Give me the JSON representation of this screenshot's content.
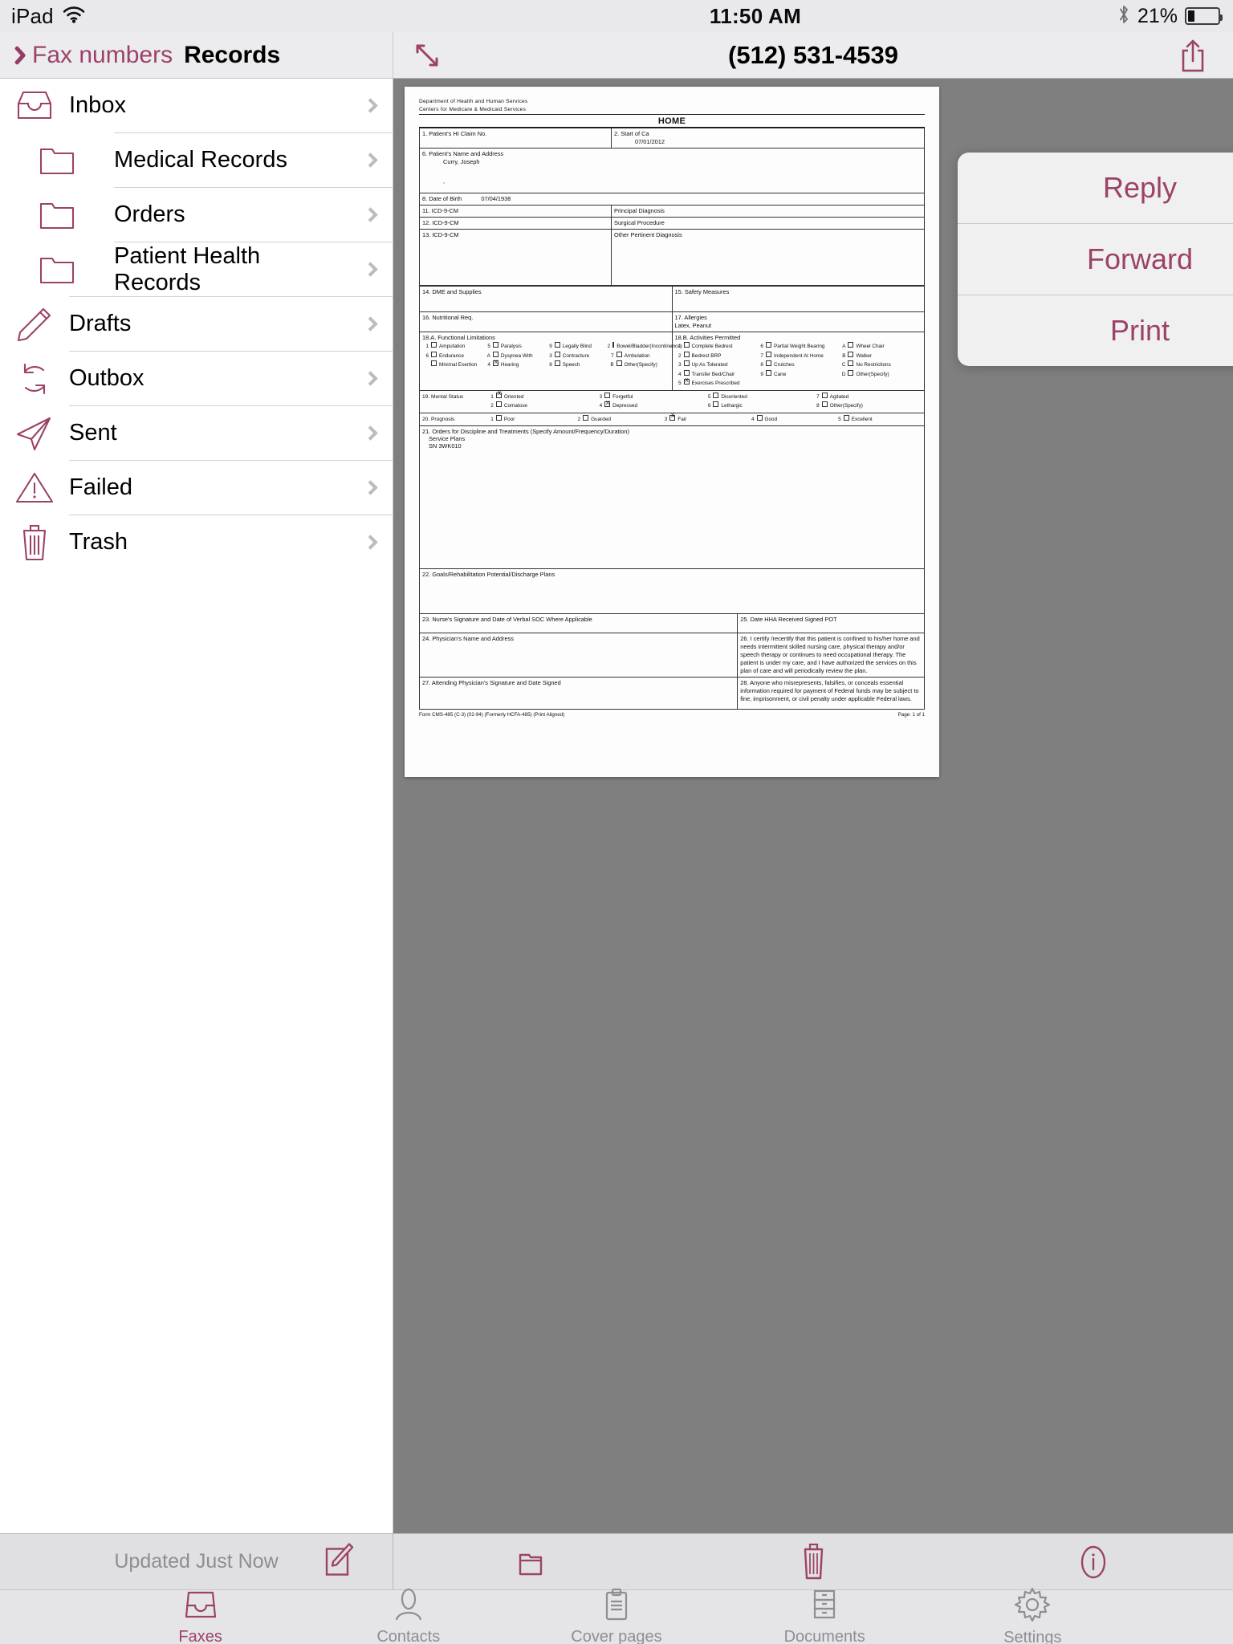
{
  "status_bar": {
    "device": "iPad",
    "wifi_icon": "wifi-icon",
    "time": "11:50 AM",
    "bluetooth_icon": "bluetooth-icon",
    "battery_percent": "21%",
    "battery_level": 21
  },
  "sidebar": {
    "back_label": "Fax numbers",
    "title": "Records",
    "items": [
      {
        "label": "Inbox",
        "icon": "inbox-tray-icon",
        "indent": false
      },
      {
        "label": "Medical Records",
        "icon": "folder-icon",
        "indent": true
      },
      {
        "label": "Orders",
        "icon": "folder-icon",
        "indent": true
      },
      {
        "label": "Patient Health Records",
        "icon": "folder-icon",
        "indent": true
      },
      {
        "label": "Drafts",
        "icon": "pencil-icon",
        "indent": false
      },
      {
        "label": "Outbox",
        "icon": "refresh-arrows-icon",
        "indent": false
      },
      {
        "label": "Sent",
        "icon": "paper-plane-icon",
        "indent": false
      },
      {
        "label": "Failed",
        "icon": "warning-triangle-icon",
        "indent": false
      },
      {
        "label": "Trash",
        "icon": "trash-icon",
        "indent": false
      }
    ]
  },
  "detail": {
    "expand_icon": "expand-diagonal-icon",
    "title": "(512) 531-4539",
    "share_icon": "share-icon"
  },
  "popover": {
    "items": [
      {
        "label": "Reply"
      },
      {
        "label": "Forward"
      },
      {
        "label": "Print"
      }
    ]
  },
  "toolbar": {
    "updated_text": "Updated Just Now",
    "compose_icon": "compose-icon",
    "folder_icon": "folder-move-icon",
    "trash_icon": "trash-icon",
    "info_icon": "info-icon"
  },
  "tabbar": {
    "tabs": [
      {
        "label": "Faxes",
        "icon": "faxes-tray-icon",
        "active": true
      },
      {
        "label": "Contacts",
        "icon": "contacts-icon",
        "active": false
      },
      {
        "label": "Cover pages",
        "icon": "clipboard-icon",
        "active": false
      },
      {
        "label": "Documents",
        "icon": "file-cabinet-icon",
        "active": false
      },
      {
        "label": "Settings",
        "icon": "gear-icon",
        "active": false
      }
    ]
  },
  "colors": {
    "accent": "#9c4268",
    "inactive": "#8e8e93",
    "chrome": "#ececee",
    "doc_background": "#7f7f7f"
  },
  "fax_document": {
    "agency_line1": "Department of Health and Human Services",
    "agency_line2": "Centers for Medicare  &  Medicaid Services",
    "form_title": "HOME",
    "field_1_label": "1. Patient's HI Claim  No.",
    "field_1_value": "",
    "field_2_label": "2. Start of Ca",
    "field_2_value": "07/01/2012",
    "field_6_label": "6. Patient's Name and Address",
    "field_6_value": "Curry, Joseph",
    "field_6_extra": ",",
    "field_8_label": "8. Date of Birth",
    "field_8_value": "07/04/1938",
    "field_11_label": "11. ICD-9-CM",
    "field_11_value": "Principal Diagnosis",
    "field_12_label": "12. ICD-9-CM",
    "field_12_value": "Surgical Procedure",
    "field_13_label": "13. ICD-9-CM",
    "field_13_value": "Other Pertinent Diagnosis",
    "field_14_label": "14. DME and Supplies",
    "field_15_label": "15. Safety Measures",
    "field_16_label": "16. Nutritional Req.",
    "field_17_label": "17. Allergies",
    "field_17_value": "Latex, Peanut",
    "field_18a_label": "18.A. Functional Limitations",
    "functional_limitations": [
      {
        "num": "1",
        "label": "Amputation",
        "checked": false
      },
      {
        "num": "5",
        "label": "Paralysis",
        "checked": false
      },
      {
        "num": "9",
        "label": "Legally Blind",
        "checked": false
      },
      {
        "num": "2",
        "label": "Bowel/Bladder(Incontinence)",
        "checked": false
      },
      {
        "num": "6",
        "label": "Endurance",
        "checked": false
      },
      {
        "num": "A",
        "label": "Dyspnea With",
        "checked": false
      },
      {
        "num": "3",
        "label": "Contracture",
        "checked": false
      },
      {
        "num": "7",
        "label": "Ambulation",
        "checked": false
      },
      {
        "num": "",
        "label": "Minimal Exertion",
        "checked": false
      },
      {
        "num": "4",
        "label": "Hearing",
        "checked": true
      },
      {
        "num": "8",
        "label": "Speech",
        "checked": false
      },
      {
        "num": "B",
        "label": "Other(Specify)",
        "checked": false
      }
    ],
    "field_18b_label": "18.B. Activities Permitted",
    "activities_permitted": [
      {
        "num": "1",
        "label": "Complete Bedrest",
        "checked": false
      },
      {
        "num": "6",
        "label": "Partial Weight Bearing",
        "checked": false
      },
      {
        "num": "A",
        "label": "Wheel Chair",
        "checked": false
      },
      {
        "num": "2",
        "label": "Bedrest BRP",
        "checked": false
      },
      {
        "num": "7",
        "label": "Independent At Home",
        "checked": false
      },
      {
        "num": "B",
        "label": "Walker",
        "checked": false
      },
      {
        "num": "3",
        "label": "Up As Tolerated",
        "checked": false
      },
      {
        "num": "8",
        "label": "Crutches",
        "checked": false
      },
      {
        "num": "C",
        "label": "No Restrictions",
        "checked": false
      },
      {
        "num": "4",
        "label": "Transfer Bed/Chair",
        "checked": false
      },
      {
        "num": "9",
        "label": "Cane",
        "checked": false
      },
      {
        "num": "D",
        "label": "Other(Specify)",
        "checked": false
      },
      {
        "num": "5",
        "label": "Exercises Prescribed",
        "checked": true
      }
    ],
    "field_19_label": "19. Mental Status",
    "mental_status": [
      {
        "num": "1",
        "label": "Oriented",
        "checked": true
      },
      {
        "num": "3",
        "label": "Forgetful",
        "checked": false
      },
      {
        "num": "5",
        "label": "Disoriented",
        "checked": false
      },
      {
        "num": "7",
        "label": "Agitated",
        "checked": false
      },
      {
        "num": "2",
        "label": "Comatose",
        "checked": false
      },
      {
        "num": "4",
        "label": "Depressed",
        "checked": true
      },
      {
        "num": "6",
        "label": "Lethargic",
        "checked": false
      },
      {
        "num": "8",
        "label": "Other(Specify)",
        "checked": false
      }
    ],
    "field_20_label": "20. Prognosis",
    "prognosis": [
      {
        "num": "1",
        "label": "Poor",
        "checked": false
      },
      {
        "num": "2",
        "label": "Guarded",
        "checked": false
      },
      {
        "num": "3",
        "label": "Fair",
        "checked": true
      },
      {
        "num": "4",
        "label": "Good",
        "checked": false
      },
      {
        "num": "5",
        "label": "Excellent",
        "checked": false
      }
    ],
    "field_21_label": "21. Orders for Discipline and Treatments (Specify Amount/Frequency/Duration)",
    "field_21_line1": "Service Plans",
    "field_21_line2": "SN  3WK010",
    "field_22_label": "22. Goals/Rehabilitation Potential/Discharge  Plans",
    "field_23_label": "23. Nurse's Signature and Date of Verbal SOC Where Applicable",
    "field_25_label": "25. Date HHA Received Signed  POT",
    "field_24_label": "24. Physician's Name and Address",
    "field_26_text": "26. I certify /recertify that this patient is confined to his/her home and needs intermittent skilled nursing care, physical therapy and/or speech therapy or continues to need occupational therapy. The patient is under my care, and I have authorized the services on this plan of care and will periodically review the plan.",
    "field_27_label": "27. Attending Physician's Signature and Date Signed",
    "field_28_text": "28. Anyone who misrepresents, falsifies, or conceals essential information required for payment of Federal funds may be subject to fine, imprisonment, or civil penalty under applicable Federal laws.",
    "form_footer": "Form CMS-485 (C-3) (02-94) (Formerly  HCFA-485)  (Print  Aligned)",
    "page_footer": "Page: 1 of 1"
  }
}
